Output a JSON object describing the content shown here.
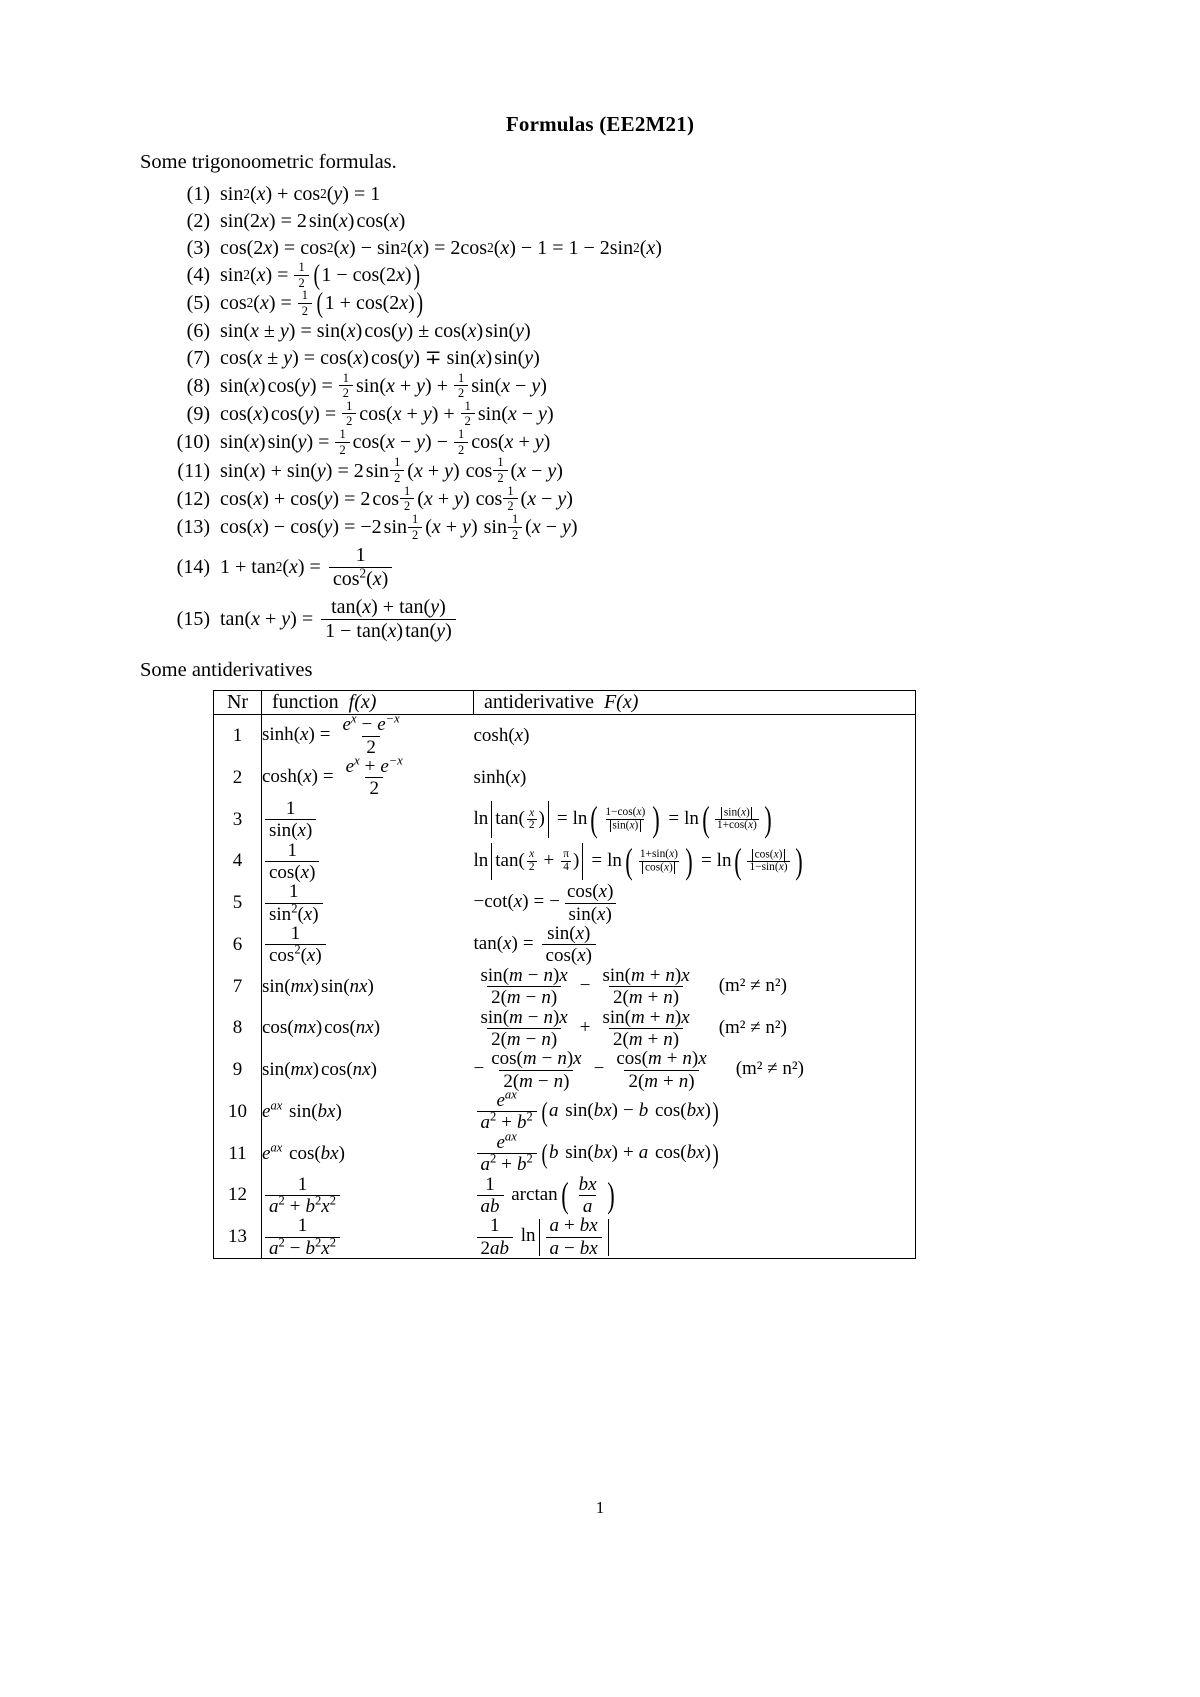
{
  "document": {
    "title": "Formulas (EE2M21)",
    "section_trig": "Some trigonoometric formulas.",
    "section_anti": "Some antiderivatives",
    "page_number": "1"
  },
  "trig_formulas": [
    {
      "num": "(1)",
      "latex": "sin^2(x) + cos^2(y) = 1"
    },
    {
      "num": "(2)",
      "latex": "sin(2x) = 2 sin(x) cos(x)"
    },
    {
      "num": "(3)",
      "latex": "cos(2x) = cos^2(x) - sin^2(x) = 2cos^2(x) - 1 = 1 - 2sin^2(x)"
    },
    {
      "num": "(4)",
      "latex": "sin^2(x) = 1/2 (1 - cos(2x))"
    },
    {
      "num": "(5)",
      "latex": "cos^2(x) = 1/2 (1 + cos(2x))"
    },
    {
      "num": "(6)",
      "latex": "sin(x ± y) = sin(x) cos(y) ± cos(x) sin(y)"
    },
    {
      "num": "(7)",
      "latex": "cos(x ± y) = cos(x) cos(y) ∓ sin(x) sin(y)"
    },
    {
      "num": "(8)",
      "latex": "sin(x) cos(y) = 1/2 sin(x + y) + 1/2 sin(x - y)"
    },
    {
      "num": "(9)",
      "latex": "cos(x) cos(y) = 1/2 cos(x + y) + 1/2 sin(x - y)"
    },
    {
      "num": "(10)",
      "latex": "sin(x) sin(y) = 1/2 cos(x - y) - 1/2 cos(x + y)"
    },
    {
      "num": "(11)",
      "latex": "sin(x) + sin(y) = 2 sin 1/2(x + y) cos 1/2(x - y)"
    },
    {
      "num": "(12)",
      "latex": "cos(x) + cos(y) = 2 cos 1/2(x + y) cos 1/2(x - y)"
    },
    {
      "num": "(13)",
      "latex": "cos(x) - cos(y) = -2 sin 1/2(x + y) sin 1/2(x - y)"
    },
    {
      "num": "(14)",
      "latex": "1 + tan^2(x) = 1 / cos^2(x)"
    },
    {
      "num": "(15)",
      "latex": "tan(x + y) = (tan(x) + tan(y)) / (1 - tan(x) tan(y))"
    }
  ],
  "table": {
    "headers": {
      "nr": "Nr",
      "function": "function",
      "function_sym": "f(x)",
      "antiderivative": "antiderivative",
      "antiderivative_sym": "F(x)"
    },
    "rows": [
      {
        "nr": "1",
        "f": "sinh(x) = (e^x - e^-x)/2",
        "F": "cosh(x)",
        "cond": ""
      },
      {
        "nr": "2",
        "f": "cosh(x) = (e^x + e^-x)/2",
        "F": "sinh(x)",
        "cond": ""
      },
      {
        "nr": "3",
        "f": "1/sin(x)",
        "F": "ln |tan(x/2)| = ln((1-cos(x))/|sin(x)|) = ln(|sin(x)|/(1+cos(x)))",
        "cond": ""
      },
      {
        "nr": "4",
        "f": "1/cos(x)",
        "F": "ln |tan(x/2 + π/4)| = ln((1+sin(x))/|cos(x)|) = ln(|cos(x)|/(1-sin(x)))",
        "cond": ""
      },
      {
        "nr": "5",
        "f": "1/sin^2(x)",
        "F": "-cot(x) = -cos(x)/sin(x)",
        "cond": ""
      },
      {
        "nr": "6",
        "f": "1/cos^2(x)",
        "F": "tan(x) = sin(x)/cos(x)",
        "cond": ""
      },
      {
        "nr": "7",
        "f": "sin(mx) sin(nx)",
        "F": "sin(m-n)x/(2(m-n)) - sin(m+n)x/(2(m+n))",
        "cond": "(m² ≠ n²)"
      },
      {
        "nr": "8",
        "f": "cos(mx) cos(nx)",
        "F": "sin(m-n)x/(2(m-n)) + sin(m+n)x/(2(m+n))",
        "cond": "(m² ≠ n²)"
      },
      {
        "nr": "9",
        "f": "sin(mx) cos(nx)",
        "F": "-cos(m-n)x/(2(m-n)) - cos(m+n)x/(2(m+n))",
        "cond": "(m² ≠ n²)"
      },
      {
        "nr": "10",
        "f": "e^ax sin(bx)",
        "F": "e^ax/(a²+b²) (a sin(bx) - b cos(bx))",
        "cond": ""
      },
      {
        "nr": "11",
        "f": "e^ax cos(bx)",
        "F": "e^ax/(a²+b²) (b sin(bx) + a cos(bx))",
        "cond": ""
      },
      {
        "nr": "12",
        "f": "1/(a² + b²x²)",
        "F": "(1/ab) arctan(bx/a)",
        "cond": ""
      },
      {
        "nr": "13",
        "f": "1/(a² - b²x²)",
        "F": "(1/2ab) ln |(a+bx)/(a-bx)|",
        "cond": ""
      }
    ]
  }
}
